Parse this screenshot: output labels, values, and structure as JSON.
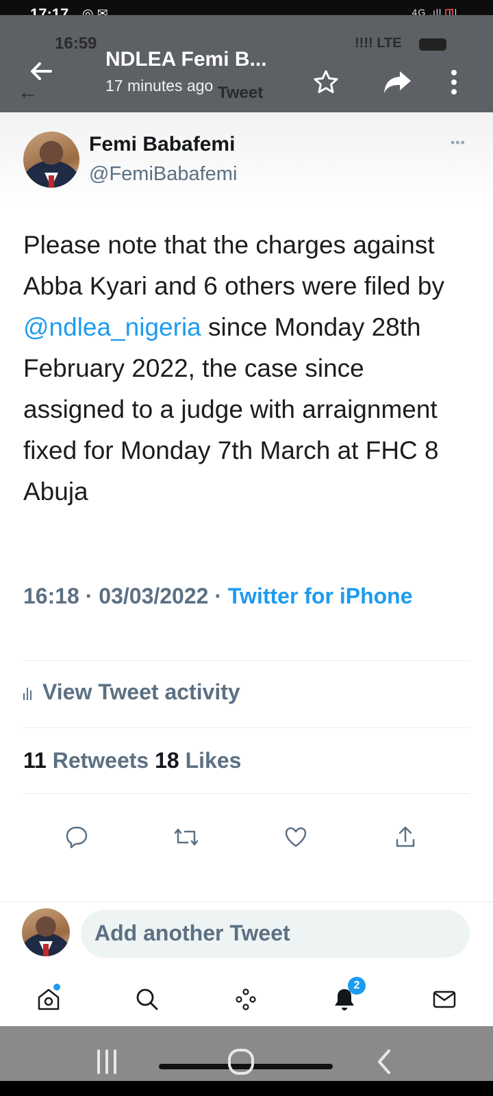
{
  "status_bar": {
    "time": "17:17",
    "icons": "◎ ✉",
    "network": "4G"
  },
  "viewer": {
    "title": "NDLEA Femi B...",
    "subtitle": "17 minutes ago"
  },
  "background_header": {
    "time": "16:59",
    "network": "LTE",
    "label": "Tweet"
  },
  "tweet": {
    "author_name": "Femi Babafemi",
    "author_handle": "@FemiBabafemi",
    "more": "•••",
    "text_part1": "Please note that the charges against Abba Kyari and 6 others were filed by ",
    "mention": "@ndlea_nigeria",
    "text_part2": " since Monday 28th February 2022, the case since assigned to a judge with arraignment fixed for Monday 7th March at FHC 8 Abuja",
    "time": "16:18",
    "date": "03/03/2022",
    "source": "Twitter for iPhone",
    "activity_label": "View Tweet activity",
    "retweets_count": "11",
    "retweets_label": "Retweets",
    "likes_count": "18",
    "likes_label": "Likes"
  },
  "compose": {
    "placeholder": "Add another Tweet"
  },
  "tabbar": {
    "notifications_badge": "2"
  },
  "colors": {
    "twitter_blue": "#1d9bf0",
    "muted": "#5b7083",
    "viewer_bar": "#5d6064"
  }
}
